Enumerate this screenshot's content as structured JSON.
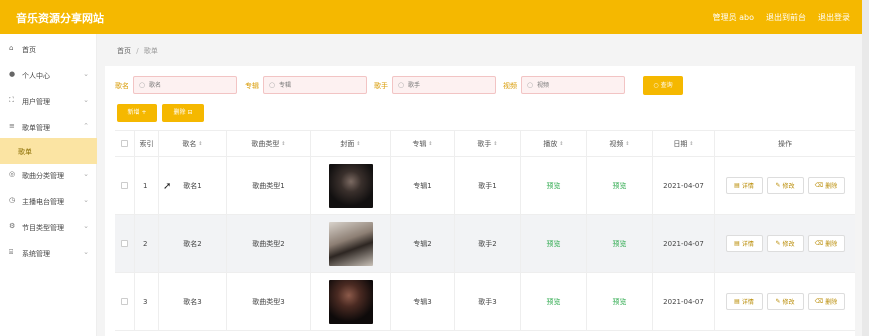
{
  "app": {
    "title": "音乐资源分享网站"
  },
  "top_links": [
    "管理员 abo",
    "退出到前台",
    "退出登录"
  ],
  "sidebar": {
    "items": [
      {
        "label": "首页",
        "icon": "home-icon",
        "has_children": false
      },
      {
        "label": "个人中心",
        "icon": "user-icon",
        "has_children": true
      },
      {
        "label": "用户管理",
        "icon": "expand-icon",
        "has_children": true
      },
      {
        "label": "歌单管理",
        "icon": "list-icon",
        "has_children": true
      },
      {
        "label": "歌单",
        "icon": "",
        "has_children": false,
        "active": true
      },
      {
        "label": "歌曲分类管理",
        "icon": "grid-icon",
        "has_children": true
      },
      {
        "label": "主播电台管理",
        "icon": "radio-icon",
        "has_children": true
      },
      {
        "label": "节目类型管理",
        "icon": "gear-icon",
        "has_children": true
      },
      {
        "label": "系统管理",
        "icon": "bank-icon",
        "has_children": true
      }
    ]
  },
  "breadcrumb": {
    "home": "首页",
    "sep": "/",
    "current": "歌单"
  },
  "search": {
    "fields": [
      {
        "label": "歌名",
        "placeholder": "歌名"
      },
      {
        "label": "专辑",
        "placeholder": "专辑"
      },
      {
        "label": "歌手",
        "placeholder": "歌手"
      },
      {
        "label": "视频",
        "placeholder": "视频"
      }
    ],
    "query_label": "查询"
  },
  "actions": {
    "add_label": "新增 +",
    "delete_label": "删除 ⊟"
  },
  "table": {
    "headers": [
      "索引",
      "歌名",
      "歌曲类型",
      "封面",
      "专辑",
      "歌手",
      "播放",
      "视频",
      "日期",
      "操作"
    ],
    "rows": [
      {
        "index": "1",
        "name": "歌名1",
        "type": "歌曲类型1",
        "album": "专辑1",
        "singer": "歌手1",
        "play": "预览",
        "video": "预览",
        "date": "2021-04-07"
      },
      {
        "index": "2",
        "name": "歌名2",
        "type": "歌曲类型2",
        "album": "专辑2",
        "singer": "歌手2",
        "play": "预览",
        "video": "预览",
        "date": "2021-04-07"
      },
      {
        "index": "3",
        "name": "歌名3",
        "type": "歌曲类型3",
        "album": "专辑3",
        "singer": "歌手3",
        "play": "预览",
        "video": "预览",
        "date": "2021-04-07"
      }
    ],
    "op_labels": {
      "detail": "详情",
      "edit": "修改",
      "delete": "删除"
    }
  },
  "colors": {
    "accent": "#f5b800",
    "active_bg": "#fbe4a3",
    "preview_green": "#2eaa4e"
  }
}
